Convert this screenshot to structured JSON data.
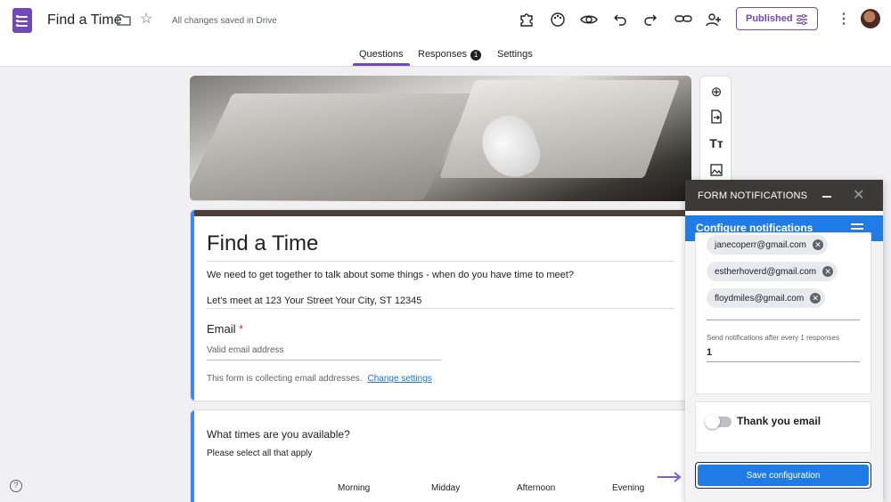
{
  "header": {
    "doc_title": "Find a Time",
    "save_status": "All changes saved in Drive",
    "publish_label": "Published",
    "icons": [
      "forms-app-icon",
      "folder-icon",
      "star-icon",
      "addon-puzzle-icon",
      "palette-icon",
      "preview-eye-icon",
      "undo-icon",
      "redo-icon",
      "link-icon",
      "add-collaborator-icon",
      "publish-settings-icon",
      "more-vert-icon",
      "avatar"
    ]
  },
  "tabs": {
    "questions": "Questions",
    "responses": "Responses",
    "responses_count": "1",
    "settings": "Settings"
  },
  "form": {
    "title": "Find a Time",
    "description": "We need to get together to talk about some things - when do you have time to meet?",
    "address": "Let's meet at 123 Your Street Your City, ST 12345",
    "email_label": "Email",
    "required_marker": "*",
    "email_placeholder": "Valid email address",
    "collect_note": "This form is collecting email addresses.",
    "change_settings": "Change settings"
  },
  "question": {
    "title": "What times are you available?",
    "subtitle": "Please select all that apply",
    "columns": [
      "Morning",
      "Midday",
      "Afternoon",
      "Evening"
    ]
  },
  "panel": {
    "header_title": "FORM NOTIFICATIONS",
    "sub_title": "Configure notifications",
    "emails": [
      "janecoperr@gmail.com",
      "estherhoverd@gmail.com",
      "floydmiles@gmail.com"
    ],
    "after_label": "Send notifications after every 1 responses",
    "after_value": "1",
    "thank_you_label": "Thank you email",
    "thank_you_enabled": false,
    "save_label": "Save configuration"
  },
  "colors": {
    "accent": "#7248b9",
    "panel_blue": "#1f7be6",
    "form_bar": "#4285f4"
  }
}
